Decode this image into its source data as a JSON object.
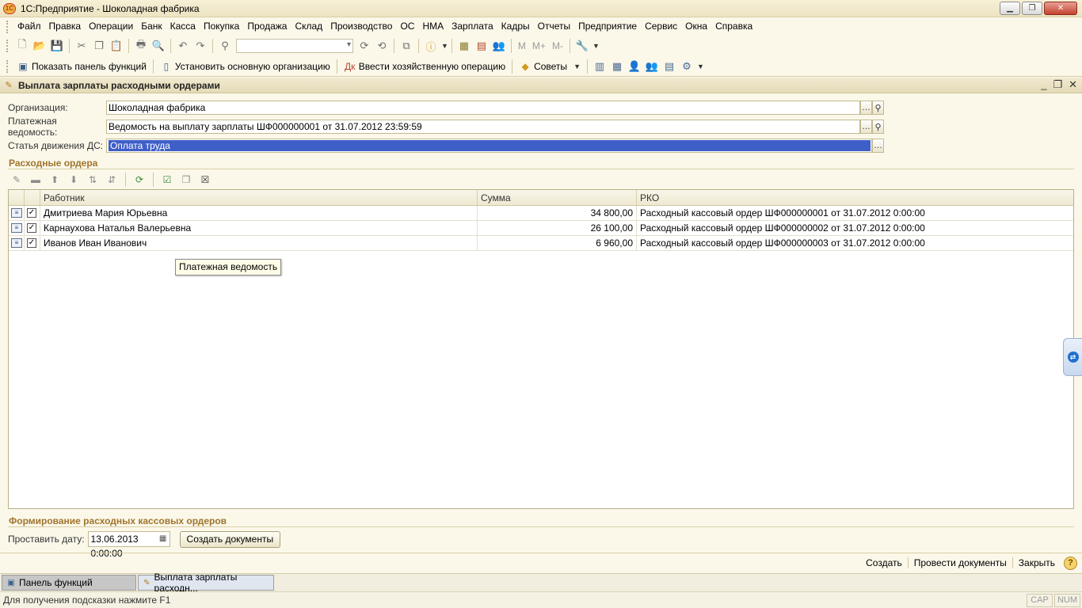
{
  "window": {
    "title": "1С:Предприятие - Шоколадная фабрика",
    "logo_text": "1C"
  },
  "menu": [
    "Файл",
    "Правка",
    "Операции",
    "Банк",
    "Касса",
    "Покупка",
    "Продажа",
    "Склад",
    "Производство",
    "ОС",
    "НМА",
    "Зарплата",
    "Кадры",
    "Отчеты",
    "Предприятие",
    "Сервис",
    "Окна",
    "Справка"
  ],
  "toolbar2": {
    "show_panel": "Показать панель функций",
    "set_org": "Установить основную организацию",
    "enter_op": "Ввести хозяйственную операцию",
    "tips": "Советы",
    "m": "M",
    "mplus": "M+",
    "mminus": "M-"
  },
  "document": {
    "title": "Выплата зарплаты расходными ордерами"
  },
  "form": {
    "org_label": "Организация:",
    "org_value": "Шоколадная фабрика",
    "statement_label": "Платежная ведомость:",
    "statement_value": "Ведомость на выплату зарплаты ШФ000000001 от 31.07.2012 23:59:59",
    "cashflow_label": "Статья движения ДС:",
    "cashflow_value": "Оплата труда"
  },
  "orders_section": {
    "title": "Расходные ордера",
    "columns": [
      "Работник",
      "Сумма",
      "РКО"
    ],
    "rows": [
      {
        "name": "Дмитриева Мария Юрьевна",
        "sum": "34 800,00",
        "rko": "Расходный кассовый ордер ШФ000000001 от 31.07.2012 0:00:00",
        "checked": true
      },
      {
        "name": "Карнаухова Наталья Валерьевна",
        "sum": "26 100,00",
        "rko": "Расходный кассовый ордер ШФ000000002 от 31.07.2012 0:00:00",
        "checked": true
      },
      {
        "name": "Иванов Иван Иванович",
        "sum": "6 960,00",
        "rko": "Расходный кассовый ордер ШФ000000003 от 31.07.2012 0:00:00",
        "checked": true
      }
    ],
    "tooltip": "Платежная ведомость"
  },
  "creation_section": {
    "title": "Формирование расходных кассовых ордеров",
    "date_label": "Проставить дату:",
    "date_value": "13.06.2013  0:00:00",
    "create_button": "Создать документы"
  },
  "footer": {
    "create": "Создать",
    "post": "Провести документы",
    "close": "Закрыть",
    "help": "?"
  },
  "tabs": [
    {
      "label": "Панель функций",
      "active": false
    },
    {
      "label": "Выплата зарплаты расходн...",
      "active": true
    }
  ],
  "status": {
    "hint": "Для получения подсказки нажмите F1",
    "cap": "CAP",
    "num": "NUM"
  }
}
